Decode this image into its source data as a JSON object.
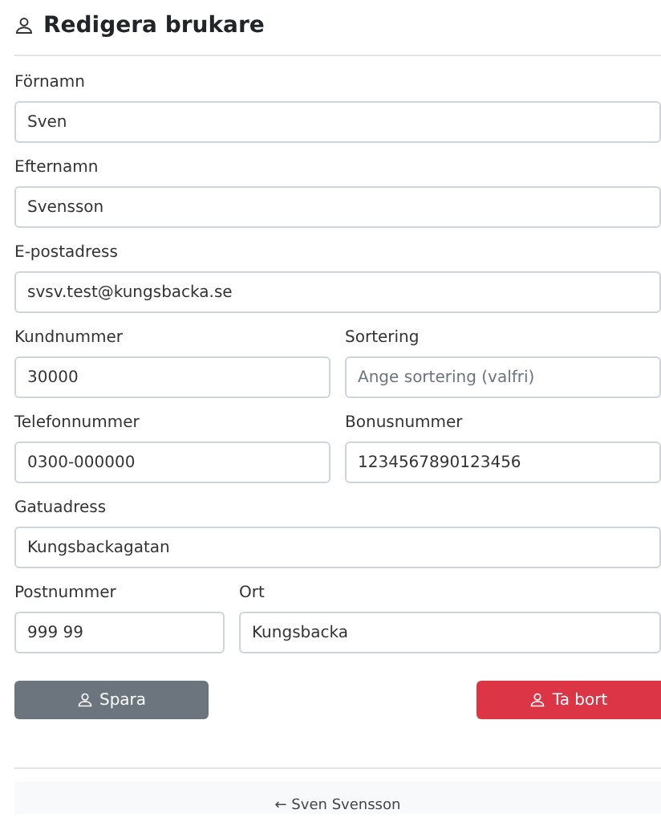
{
  "title": "Redigera brukare",
  "rows": [
    [
      {
        "label": "Förnamn",
        "value": "Sven"
      }
    ],
    [
      {
        "label": "Efternamn",
        "value": "Svensson"
      }
    ],
    [
      {
        "label": "E-postadress",
        "value": "svsv.test@kungsbacka.se"
      }
    ],
    [
      {
        "label": "Kundnummer",
        "value": "30000"
      },
      {
        "label": "Sortering",
        "placeholder": "Ange sortering (valfri)"
      }
    ],
    [
      {
        "label": "Telefonnummer",
        "value": "0300-000000"
      },
      {
        "label": "Bonusnummer",
        "value": "1234567890123456"
      }
    ],
    [
      {
        "label": "Gatuadress",
        "value": "Kungsbackagatan"
      }
    ],
    [
      {
        "label": "Postnummer",
        "value": "999 99",
        "kind": "narrow"
      },
      {
        "label": "Ort",
        "value": "Kungsbacka"
      }
    ]
  ],
  "buttons": [
    {
      "label": "Spara",
      "kind": "secondary"
    },
    {
      "label": "Ta bort",
      "kind": "danger"
    }
  ],
  "footer_link": "← Sven Svensson"
}
